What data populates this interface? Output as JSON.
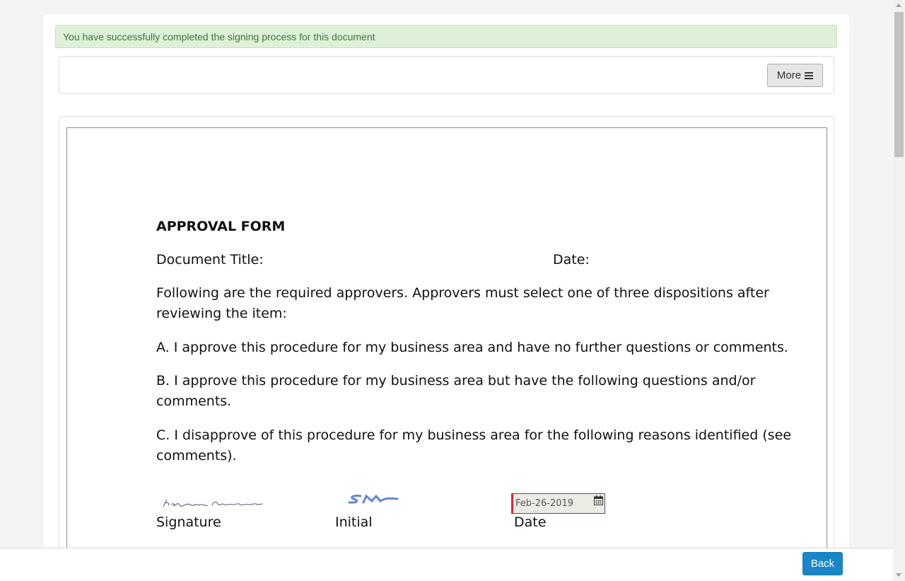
{
  "alert": {
    "message": "You have successfully completed the signing process for this document"
  },
  "toolbar": {
    "more_label": "More"
  },
  "document": {
    "title": "APPROVAL FORM",
    "doc_title_label": "Document Title:",
    "date_label": "Date:",
    "intro_line1": "Following are the required approvers. Approvers must select one of three dispositions after",
    "intro_line2": "reviewing the item:",
    "option_a": "A. I approve this procedure for my business area and have no further questions or comments.",
    "option_b_line1": "B. I approve this procedure for my business area but have the following questions and/or",
    "option_b_line2": "comments.",
    "option_c_line1": "C. I disapprove of this procedure for my business area for the following reasons identified (see",
    "option_c_line2": "comments).",
    "signature_block": {
      "signature_label": "Signature",
      "initial_label": "Initial",
      "date_label": "Date",
      "signature_text": "Kalyan Kumar",
      "initial_text": "SM",
      "date_value": "Feb-26-2019"
    }
  },
  "footer": {
    "back_label": "Back"
  },
  "colors": {
    "accent": "#1a86c8",
    "alert_bg": "#dff0d8",
    "alert_text": "#3c763d",
    "required_marker": "#e5252a"
  },
  "icons": {
    "menu": "hamburger-icon",
    "calendar": "calendar-icon"
  }
}
